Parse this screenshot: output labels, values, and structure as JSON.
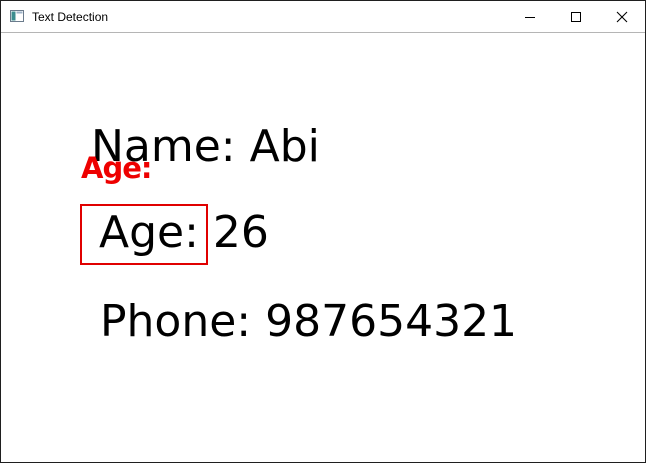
{
  "window": {
    "title": "Text Detection",
    "icon": "app-window-icon"
  },
  "caption_buttons": {
    "minimize_icon": "minimize-icon",
    "maximize_icon": "maximize-icon",
    "close_icon": "close-icon"
  },
  "image": {
    "lines": {
      "name": "Name: Abi",
      "age": "Age: 26",
      "phone": "Phone: 987654321"
    },
    "detection": {
      "label": "Age:",
      "box_color": "#e00000",
      "label_color": "#ee0000"
    }
  }
}
